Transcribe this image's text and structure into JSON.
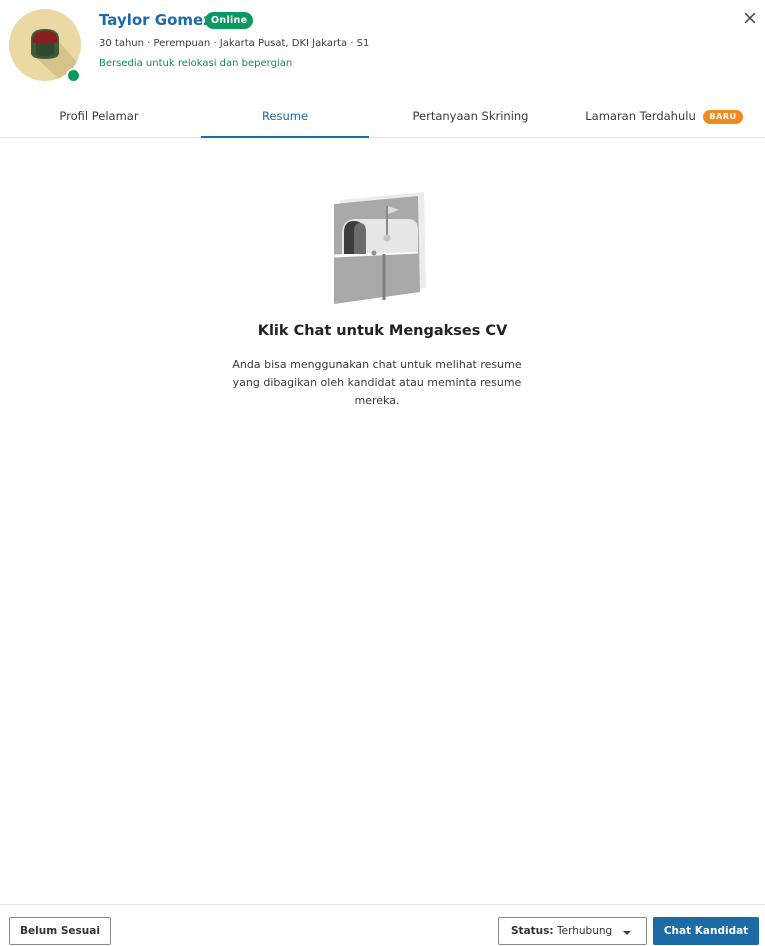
{
  "candidate": {
    "name": "Taylor Gomez",
    "online_badge": "Online",
    "meta": "30 tahun · Perempuan · Jakarta Pusat, DKI Jakarta · S1",
    "relocation": "Bersedia untuk relokasi dan bepergian"
  },
  "tabs": [
    {
      "label": "Profil Pelamar",
      "active": false
    },
    {
      "label": "Resume",
      "active": true
    },
    {
      "label": "Pertanyaan Skrining",
      "active": false
    },
    {
      "label": "Lamaran Terdahulu",
      "badge": "BARU",
      "active": false
    }
  ],
  "empty_state": {
    "title": "Klik Chat untuk Mengakses CV",
    "description": "Anda bisa menggunakan chat untuk melihat resume yang dibagikan oleh kandidat atau meminta resume mereka."
  },
  "footer": {
    "reject_label": "Belum Sesuai",
    "status_label": "Status:",
    "status_value": "Terhubung",
    "chat_label": "Chat Kandidat"
  },
  "colors": {
    "brand_blue": "#1c6aa6",
    "online_green": "#0d9a60",
    "badge_orange": "#f08a1e"
  },
  "icons": {
    "close": "close-icon",
    "caret": "caret-down-icon",
    "illustration": "mailbox-illustration"
  }
}
